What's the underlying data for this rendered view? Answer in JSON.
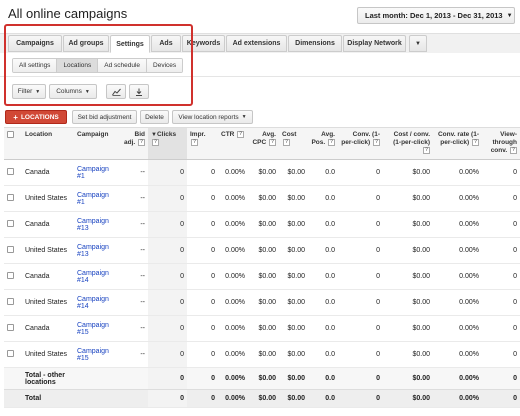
{
  "page_title": "All online campaigns",
  "date_range": {
    "label": "Last month:",
    "value": "Dec 1, 2013 - Dec 31, 2013"
  },
  "tabs": [
    {
      "label": "Campaigns",
      "active": false
    },
    {
      "label": "Ad groups",
      "active": false
    },
    {
      "label": "Settings",
      "active": true
    },
    {
      "label": "Ads",
      "active": false
    },
    {
      "label": "Keywords",
      "active": false
    },
    {
      "label": "Ad extensions",
      "active": false
    },
    {
      "label": "Dimensions",
      "active": false
    },
    {
      "label": "Display Network",
      "active": false
    }
  ],
  "subtabs": [
    {
      "label": "All settings",
      "active": false
    },
    {
      "label": "Locations",
      "active": true
    },
    {
      "label": "Ad schedule",
      "active": false
    },
    {
      "label": "Devices",
      "active": false
    }
  ],
  "toolbar": {
    "filter_label": "Filter",
    "columns_label": "Columns"
  },
  "actions": {
    "locations_label": "LOCATIONS",
    "set_bid_label": "Set bid adjustment",
    "delete_label": "Delete",
    "view_reports_label": "View location reports"
  },
  "columns": {
    "location": "Location",
    "campaign": "Campaign",
    "bid_adj": "Bid adj.",
    "clicks": "Clicks",
    "impr": "Impr.",
    "ctr": "CTR",
    "avg_cpc": "Avg. CPC",
    "cost": "Cost",
    "avg_pos": "Avg. Pos.",
    "conv": "Conv. (1-per-click)",
    "cost_conv": "Cost / conv. (1-per-click)",
    "conv_rate": "Conv. rate (1-per-click)",
    "view_through": "View-through conv."
  },
  "rows": [
    {
      "location": "Canada",
      "campaign": "Campaign #1",
      "bid_adj": "--",
      "clicks": "0",
      "impr": "0",
      "ctr": "0.00%",
      "avg_cpc": "$0.00",
      "cost": "$0.00",
      "avg_pos": "0.0",
      "conv": "0",
      "cost_conv": "$0.00",
      "conv_rate": "0.00%",
      "view_through": "0"
    },
    {
      "location": "United States",
      "campaign": "Campaign #1",
      "bid_adj": "--",
      "clicks": "0",
      "impr": "0",
      "ctr": "0.00%",
      "avg_cpc": "$0.00",
      "cost": "$0.00",
      "avg_pos": "0.0",
      "conv": "0",
      "cost_conv": "$0.00",
      "conv_rate": "0.00%",
      "view_through": "0"
    },
    {
      "location": "Canada",
      "campaign": "Campaign #13",
      "bid_adj": "--",
      "clicks": "0",
      "impr": "0",
      "ctr": "0.00%",
      "avg_cpc": "$0.00",
      "cost": "$0.00",
      "avg_pos": "0.0",
      "conv": "0",
      "cost_conv": "$0.00",
      "conv_rate": "0.00%",
      "view_through": "0"
    },
    {
      "location": "United States",
      "campaign": "Campaign #13",
      "bid_adj": "--",
      "clicks": "0",
      "impr": "0",
      "ctr": "0.00%",
      "avg_cpc": "$0.00",
      "cost": "$0.00",
      "avg_pos": "0.0",
      "conv": "0",
      "cost_conv": "$0.00",
      "conv_rate": "0.00%",
      "view_through": "0"
    },
    {
      "location": "Canada",
      "campaign": "Campaign #14",
      "bid_adj": "--",
      "clicks": "0",
      "impr": "0",
      "ctr": "0.00%",
      "avg_cpc": "$0.00",
      "cost": "$0.00",
      "avg_pos": "0.0",
      "conv": "0",
      "cost_conv": "$0.00",
      "conv_rate": "0.00%",
      "view_through": "0"
    },
    {
      "location": "United States",
      "campaign": "Campaign #14",
      "bid_adj": "--",
      "clicks": "0",
      "impr": "0",
      "ctr": "0.00%",
      "avg_cpc": "$0.00",
      "cost": "$0.00",
      "avg_pos": "0.0",
      "conv": "0",
      "cost_conv": "$0.00",
      "conv_rate": "0.00%",
      "view_through": "0"
    },
    {
      "location": "Canada",
      "campaign": "Campaign #15",
      "bid_adj": "--",
      "clicks": "0",
      "impr": "0",
      "ctr": "0.00%",
      "avg_cpc": "$0.00",
      "cost": "$0.00",
      "avg_pos": "0.0",
      "conv": "0",
      "cost_conv": "$0.00",
      "conv_rate": "0.00%",
      "view_through": "0"
    },
    {
      "location": "United States",
      "campaign": "Campaign #15",
      "bid_adj": "--",
      "clicks": "0",
      "impr": "0",
      "ctr": "0.00%",
      "avg_cpc": "$0.00",
      "cost": "$0.00",
      "avg_pos": "0.0",
      "conv": "0",
      "cost_conv": "$0.00",
      "conv_rate": "0.00%",
      "view_through": "0"
    }
  ],
  "total_other": {
    "label": "Total - other locations",
    "clicks": "0",
    "impr": "0",
    "ctr": "0.00%",
    "avg_cpc": "$0.00",
    "cost": "$0.00",
    "avg_pos": "0.0",
    "conv": "0",
    "cost_conv": "$0.00",
    "conv_rate": "0.00%",
    "view_through": "0"
  },
  "total": {
    "label": "Total",
    "clicks": "0",
    "impr": "0",
    "ctr": "0.00%",
    "avg_cpc": "$0.00",
    "cost": "$0.00",
    "avg_pos": "0.0",
    "conv": "0",
    "cost_conv": "$0.00",
    "conv_rate": "0.00%",
    "view_through": "0"
  },
  "colors": {
    "accent_red": "#d14836",
    "highlight_red": "#d0312d",
    "link_blue": "#1a44c1"
  }
}
